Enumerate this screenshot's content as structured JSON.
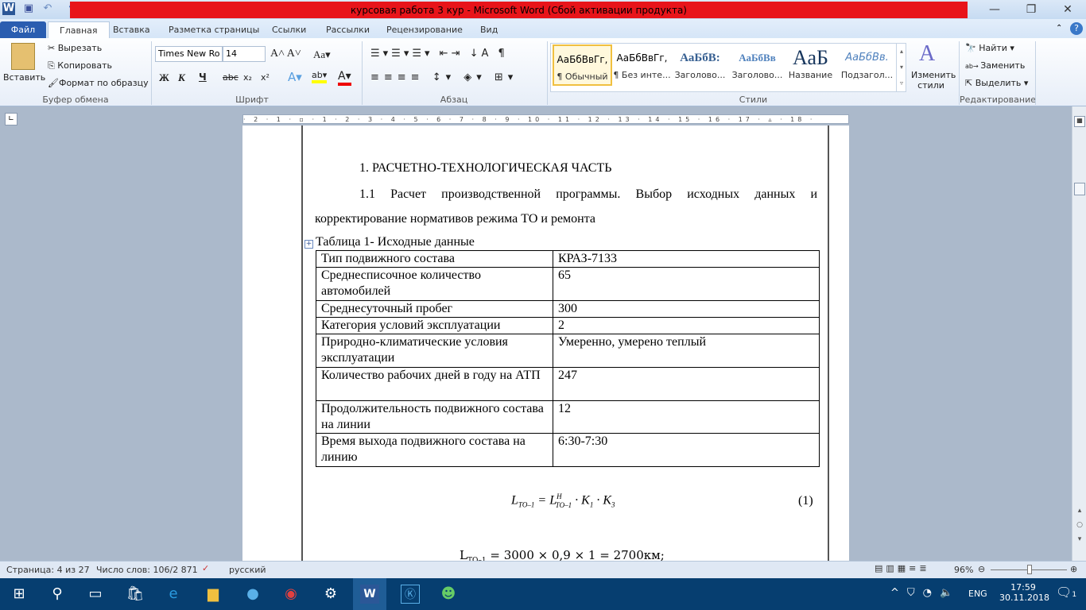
{
  "window": {
    "title": "курсовая работа 3 кур  -  Microsoft Word (Сбой активации продукта)"
  },
  "tabs": [
    "Файл",
    "Главная",
    "Вставка",
    "Разметка страницы",
    "Ссылки",
    "Рассылки",
    "Рецензирование",
    "Вид"
  ],
  "clipboard": {
    "paste": "Вставить",
    "cut": "Вырезать",
    "copy": "Копировать",
    "format_painter": "Формат по образцу",
    "group": "Буфер обмена"
  },
  "font": {
    "name": "Times New Ro",
    "size": "14",
    "group": "Шрифт",
    "bold": "Ж",
    "italic": "К",
    "underline": "Ч",
    "strike": "abc",
    "sub": "x₂",
    "sup": "x²"
  },
  "paragraph": {
    "group": "Абзац"
  },
  "styles": {
    "group": "Стили",
    "items": [
      {
        "preview": "АаБбВвГг,",
        "name": "¶ Обычный"
      },
      {
        "preview": "АаБбВвГг,",
        "name": "¶ Без инте..."
      },
      {
        "preview": "АаБбВ:",
        "name": "Заголово..."
      },
      {
        "preview": "АаБбВв",
        "name": "Заголово..."
      },
      {
        "preview": "АаБ",
        "name": "Название"
      },
      {
        "preview": "АаБбВв.",
        "name": "Подзагол..."
      }
    ],
    "change": "Изменить стили"
  },
  "editing": {
    "group": "Редактирование",
    "find": "Найти",
    "replace": "Заменить",
    "select": "Выделить"
  },
  "ruler": "· 2 · 1 · ▫ · 1 · 2 · 3 · 4 · 5 · 6 · 7 · 8 · 9 · 10 · 11 · 12 · 13 · 14 · 15 · 16 · 17 · ▵ · 18 ·",
  "document": {
    "heading": "1. РАСЧЕТНО-ТЕХНОЛОГИЧЕСКАЯ ЧАСТЬ",
    "subheading_line1": "1.1 Расчет производственной программы. Выбор исходных данных и",
    "subheading_line2": "корректирование нормативов режима ТО и ремонта",
    "table_caption": "Таблица 1- Исходные данные",
    "table": [
      [
        "Тип подвижного состава",
        "КРАЗ-7133"
      ],
      [
        "Среднесписочное количество автомобилей",
        "65"
      ],
      [
        "Среднесуточный пробег",
        "300"
      ],
      [
        "Категория условий эксплуатации",
        "2"
      ],
      [
        "Природно-климатические условия эксплуатации",
        "Умеренно, умерено теплый"
      ],
      [
        "Количество рабочих дней в году на АТП",
        "247"
      ],
      [
        "Продолжительность подвижного состава на линии",
        "12"
      ],
      [
        "Время выхода подвижного состава на линию",
        "6:30-7:30"
      ]
    ],
    "formula_number": "(1)",
    "calc": "= 3000 × 0,9 × 1 = 2700км;"
  },
  "status": {
    "page": "Страница: 4 из 27",
    "words": "Число слов: 106/2 871",
    "language": "русский",
    "zoom": "96%",
    "zoom_value": 96
  },
  "tray": {
    "lang": "ENG",
    "time": "17:59",
    "date": "30.11.2018",
    "notifications": "1"
  }
}
